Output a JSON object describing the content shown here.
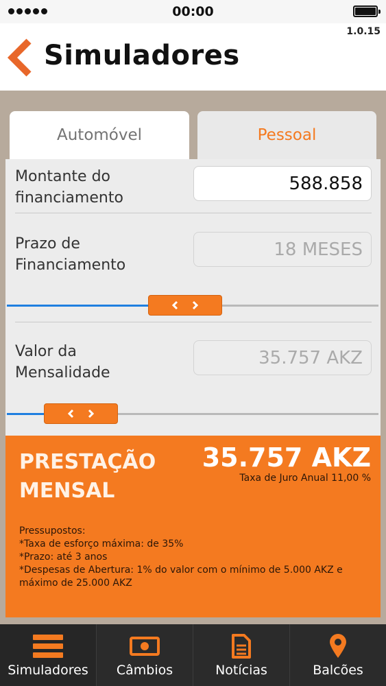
{
  "status_bar": {
    "time": "00:00"
  },
  "header": {
    "title": "Simuladores",
    "version": "1.0.15"
  },
  "tabs": [
    {
      "label": "Automóvel",
      "active": false
    },
    {
      "label": "Pessoal",
      "active": true
    }
  ],
  "form": {
    "amount": {
      "label_line1": "Montante do",
      "label_line2": "financiamento",
      "value": "588.858"
    },
    "term": {
      "label_line1": "Prazo de",
      "label_line2": "Financiamento",
      "value": "18 MESES",
      "slider_fraction": 0.48
    },
    "monthly": {
      "label_line1": "Valor da",
      "label_line2": "Mensalidade",
      "value": "35.757 AKZ",
      "slider_fraction": 0.2
    }
  },
  "result": {
    "label_line1": "PRESTAÇÃO",
    "label_line2": "MENSAL",
    "value": "35.757 AKZ",
    "rate": "Taxa de Juro Anual 11,00 %",
    "assumptions": [
      "Pressupostos:",
      "*Taxa de esforço máxima: de 35%",
      "*Prazo: até 3 anos",
      "*Despesas de Abertura: 1% do valor com o mínimo de 5.000 AKZ e máximo de 25.000 AKZ"
    ]
  },
  "nav": [
    {
      "label": "Simuladores",
      "icon": "simulators-icon"
    },
    {
      "label": "Câmbios",
      "icon": "banknote-icon"
    },
    {
      "label": "Notícias",
      "icon": "document-icon"
    },
    {
      "label": "Balcões",
      "icon": "location-pin-icon"
    }
  ],
  "colors": {
    "accent": "#f47a20",
    "slider_fill": "#1f7fe0",
    "nav_background": "#2b2b2b"
  }
}
